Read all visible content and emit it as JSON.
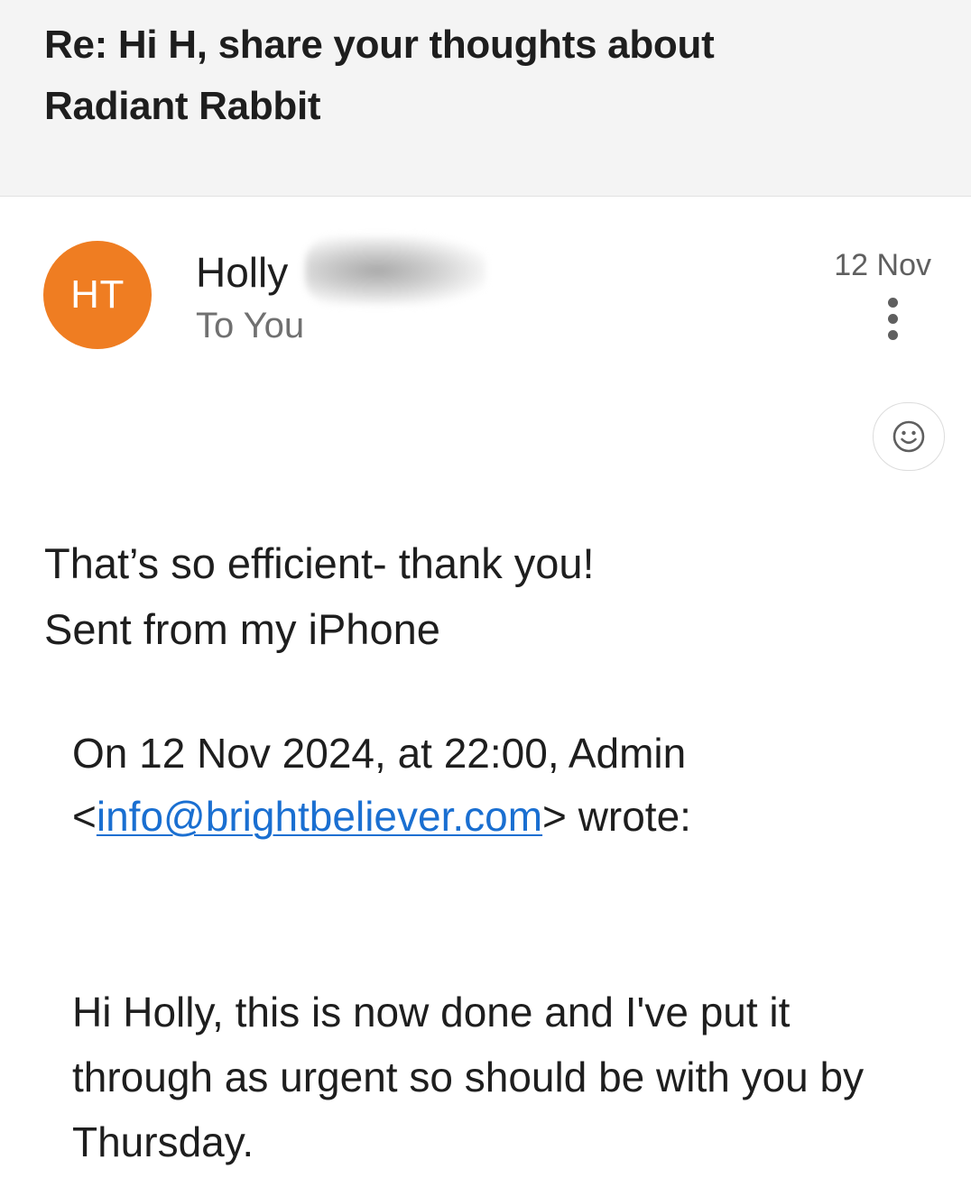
{
  "email": {
    "subject_line1": "Re: Hi H, share your thoughts about",
    "subject_line2": "Radiant Rabbit",
    "sender": {
      "initials": "HT",
      "name": "Holly",
      "avatar_color": "#ef7d22"
    },
    "recipient_label": "To You",
    "date": "12 Nov",
    "body": {
      "line1": "That’s so efficient- thank you!",
      "line2": "Sent from my iPhone"
    },
    "quote": {
      "header_line1": "On 12 Nov 2024, at 22:00, Admin",
      "open_bracket": "<",
      "email_link": "info@brightbeliever.com",
      "close_text": "> wrote:",
      "body_text": "Hi Holly, this is now done and I've put it through as urgent so should be with you by Thursday."
    }
  },
  "icons": {
    "more": "more-vertical-icon",
    "reaction": "smiley-icon"
  },
  "colors": {
    "link": "#1a6fd1",
    "subject_bg": "#f4f4f4"
  }
}
